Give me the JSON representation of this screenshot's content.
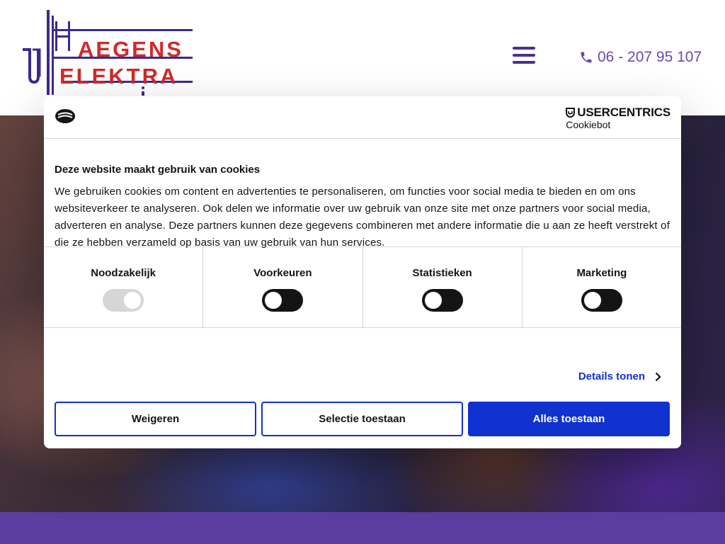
{
  "header": {
    "logo": {
      "line1_red": "AEGENS",
      "line2_red": "ELEKTRA"
    },
    "phone": "06 - 207 95 107"
  },
  "cookie_dialog": {
    "brand_top": "USERCENTRICS",
    "brand_bottom": "Cookiebot",
    "title": "Deze website maakt gebruik van cookies",
    "text": "We gebruiken cookies om content en advertenties te personaliseren, om functies voor social media te bieden en om ons websiteverkeer te analyseren. Ook delen we informatie over uw gebruik van onze site met onze partners voor social media, adverteren en analyse. Deze partners kunnen deze gegevens combineren met andere informatie die u aan ze heeft verstrekt of die ze hebben verzameld op basis van uw gebruik van hun services.",
    "categories": [
      {
        "label": "Noodzakelijk",
        "enabled": true,
        "locked": true
      },
      {
        "label": "Voorkeuren",
        "enabled": false,
        "locked": false
      },
      {
        "label": "Statistieken",
        "enabled": false,
        "locked": false
      },
      {
        "label": "Marketing",
        "enabled": false,
        "locked": false
      }
    ],
    "details_label": "Details tonen",
    "buttons": {
      "reject": "Weigeren",
      "selection": "Selectie toestaan",
      "allow_all": "Alles toestaan"
    }
  },
  "colors": {
    "accent_blue": "#1032cf",
    "brand_purple": "#5b3fa0",
    "logo_red": "#d12a2a",
    "logo_navy": "#3b2a8f"
  },
  "icons": [
    "menu-icon",
    "phone-icon",
    "cookie-icon",
    "usercentrics-shield-icon",
    "chevron-right-icon"
  ]
}
